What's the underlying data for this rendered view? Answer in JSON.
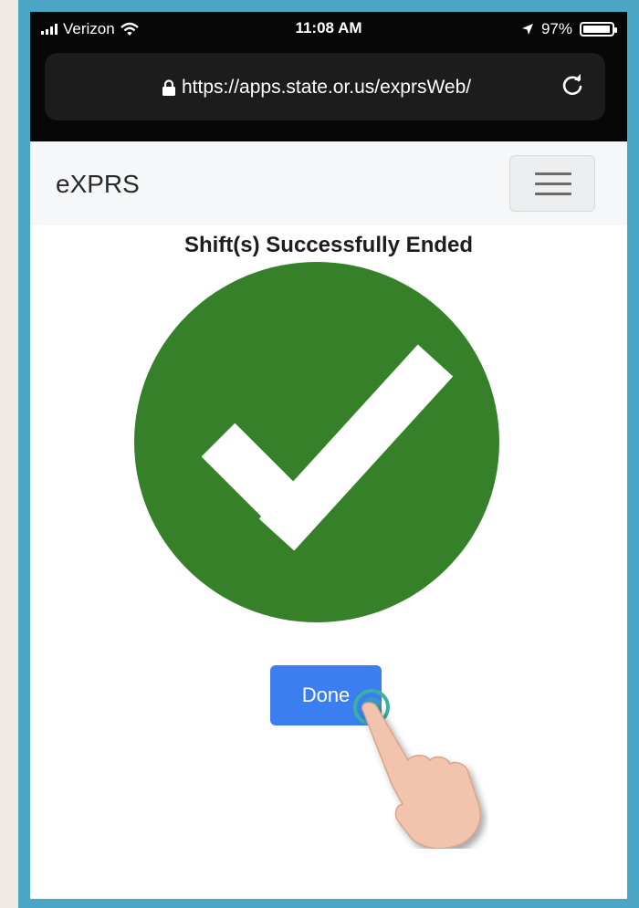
{
  "status_bar": {
    "carrier": "Verizon",
    "time": "11:08 AM",
    "battery": "97%"
  },
  "browser": {
    "url": "https://apps.state.or.us/exprsWeb/"
  },
  "navbar": {
    "brand": "eXPRS"
  },
  "main": {
    "title": "Shift(s) Successfully Ended",
    "done_label": "Done"
  },
  "colors": {
    "success_green": "#37802a",
    "button_blue": "#3b7ef0",
    "frame_border": "#4aa6c4"
  },
  "icons": [
    "signal-icon",
    "wifi-icon",
    "location-arrow-icon",
    "battery-icon",
    "lock-icon",
    "reload-icon",
    "hamburger-menu-icon",
    "checkmark-icon",
    "pointing-hand-icon"
  ]
}
